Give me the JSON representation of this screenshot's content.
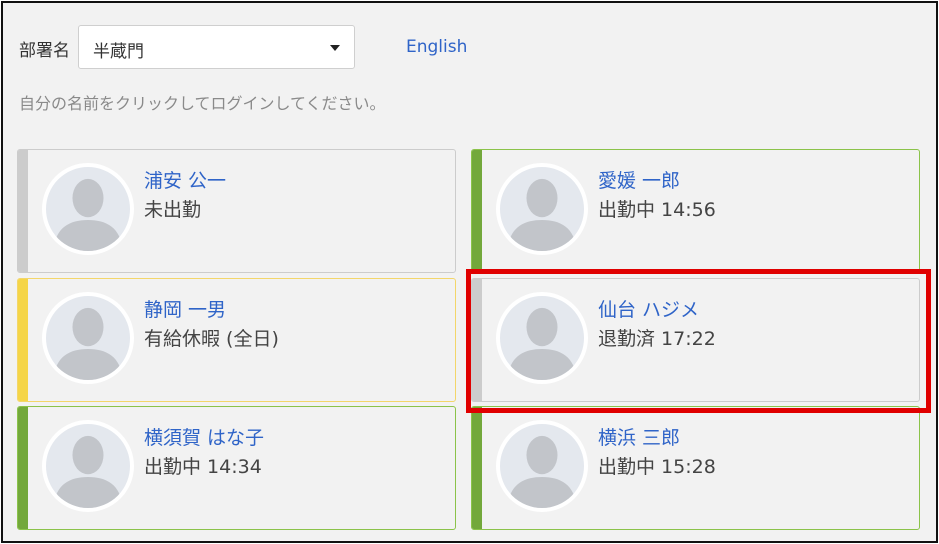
{
  "department": {
    "label": "部署名",
    "selected": "半蔵門"
  },
  "language_link": "English",
  "instruction": "自分の名前をクリックしてログインしてください。",
  "employees": [
    {
      "name": "浦安 公一",
      "status": "未出勤",
      "status_color": "#cccccc",
      "border_color": "#cccccc"
    },
    {
      "name": "愛媛 一郎",
      "status": "出勤中 14:56",
      "status_color": "#73a83b",
      "border_color": "#8bc34a"
    },
    {
      "name": "静岡 一男",
      "status": "有給休暇 (全日)",
      "status_color": "#f5d547",
      "border_color": "#f3d66a"
    },
    {
      "name": "仙台 ハジメ",
      "status": "退勤済 17:22",
      "status_color": "#cccccc",
      "border_color": "#cccccc"
    },
    {
      "name": "横須賀 はな子",
      "status": "出勤中 14:34",
      "status_color": "#73a83b",
      "border_color": "#8bc34a"
    },
    {
      "name": "横浜 三郎",
      "status": "出勤中 15:28",
      "status_color": "#73a83b",
      "border_color": "#8bc34a"
    }
  ],
  "avatar_icon": "person-silhouette-icon",
  "highlight": {
    "target": "仙台 ハジメ",
    "color": "#e00000"
  }
}
